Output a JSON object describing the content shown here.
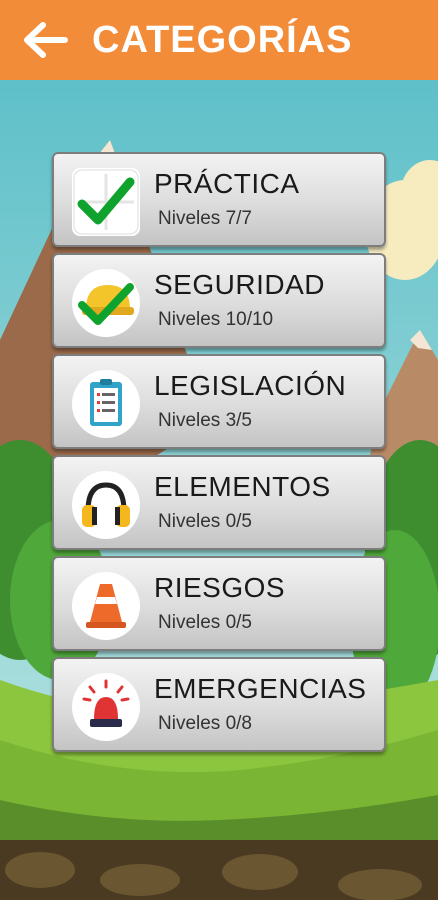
{
  "header": {
    "title": "CATEGORÍAS",
    "back_icon": "arrow-left-icon"
  },
  "colors": {
    "header": "#F28C38",
    "sky": "#6EC6C7",
    "grass": "#8CC63F",
    "check": "#0FA32E"
  },
  "categories": [
    {
      "title": "PRÁCTICA",
      "levels": "Niveles 7/7",
      "icon": "puzzle-check-icon"
    },
    {
      "title": "SEGURIDAD",
      "levels": "Niveles 10/10",
      "icon": "helmet-check-icon"
    },
    {
      "title": "LEGISLACIÓN",
      "levels": "Niveles 3/5",
      "icon": "clipboard-icon"
    },
    {
      "title": "ELEMENTOS",
      "levels": "Niveles 0/5",
      "icon": "headphones-icon"
    },
    {
      "title": "RIESGOS",
      "levels": "Niveles 0/5",
      "icon": "traffic-cone-icon"
    },
    {
      "title": "EMERGENCIAS",
      "levels": "Niveles 0/8",
      "icon": "siren-icon"
    }
  ]
}
